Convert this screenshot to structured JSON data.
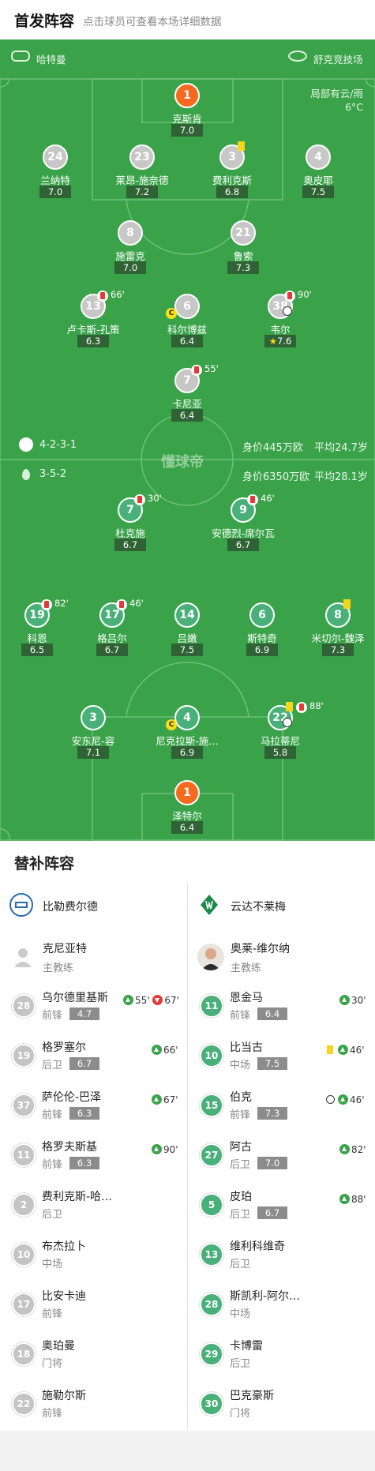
{
  "header": {
    "title": "首发阵容",
    "hint": "点击球员可查看本场详细数据"
  },
  "pitch": {
    "referee": "哈特曼",
    "stadium": "舒克竞技场",
    "weather": "局部有云/雨",
    "temperature": "6°C",
    "watermark": "懂球帝",
    "home_summary": {
      "formation": "4-2-3-1",
      "value": "身价445万欧",
      "age": "平均24.7岁"
    },
    "away_summary": {
      "formation": "3-5-2",
      "value": "身价6350万欧",
      "age": "平均28.1岁"
    }
  },
  "home_lineup": [
    {
      "num": "1",
      "name": "克斯肯",
      "rating": "7.0",
      "gk": true
    },
    {
      "num": "24",
      "name": "兰纳特",
      "rating": "7.0"
    },
    {
      "num": "23",
      "name": "莱昂-施奈德",
      "rating": "7.2"
    },
    {
      "num": "3",
      "name": "费利克斯",
      "rating": "6.8",
      "yellow": true
    },
    {
      "num": "4",
      "name": "奥皮耶",
      "rating": "7.5"
    },
    {
      "num": "8",
      "name": "施雷克",
      "rating": "7.0"
    },
    {
      "num": "21",
      "name": "鲁索",
      "rating": "7.3"
    },
    {
      "num": "13",
      "name": "卢卡斯-孔策",
      "rating": "6.3",
      "sub_time": "66'"
    },
    {
      "num": "6",
      "name": "科尔博兹",
      "rating": "6.4",
      "captain": true
    },
    {
      "num": "38",
      "name": "韦尔",
      "rating": "7.6",
      "sub_time": "90'",
      "goal": true,
      "star": true
    },
    {
      "num": "7",
      "name": "卡尼亚",
      "rating": "6.4",
      "sub_time": "55'"
    }
  ],
  "away_lineup": [
    {
      "num": "7",
      "name": "杜克施",
      "rating": "6.7",
      "sub_time": "30'"
    },
    {
      "num": "9",
      "name": "安德烈-席尔瓦",
      "rating": "6.7",
      "sub_time": "46'"
    },
    {
      "num": "19",
      "name": "科恩",
      "rating": "6.5",
      "sub_time": "82'"
    },
    {
      "num": "17",
      "name": "格吕尔",
      "rating": "6.7",
      "sub_time": "46'"
    },
    {
      "num": "14",
      "name": "吕嫩",
      "rating": "7.5"
    },
    {
      "num": "6",
      "name": "斯特奇",
      "rating": "6.9"
    },
    {
      "num": "8",
      "name": "米切尔-魏泽",
      "rating": "7.3",
      "yellow": true
    },
    {
      "num": "3",
      "name": "安东尼-容",
      "rating": "7.1"
    },
    {
      "num": "4",
      "name": "尼克拉斯-施…",
      "rating": "6.9",
      "captain": true
    },
    {
      "num": "22",
      "name": "马拉蒂尼",
      "rating": "5.8",
      "sub_time": "88'",
      "yellow": true,
      "goal": true
    },
    {
      "num": "1",
      "name": "泽特尔",
      "rating": "6.4",
      "gk": true
    }
  ],
  "subs": {
    "title": "替补阵容",
    "home": {
      "team": "比勒费尔德",
      "coach": {
        "name": "克尼亚特",
        "role": "主教练"
      },
      "players": [
        {
          "num": "28",
          "name": "乌尔德里基斯",
          "pos": "前锋",
          "rating": "4.7",
          "in": "55'",
          "out": "67'"
        },
        {
          "num": "19",
          "name": "格罗塞尔",
          "pos": "后卫",
          "rating": "6.7",
          "in": "66'"
        },
        {
          "num": "37",
          "name": "萨伦伦-巴泽",
          "pos": "前锋",
          "rating": "6.3",
          "in": "67'"
        },
        {
          "num": "11",
          "name": "格罗夫斯基",
          "pos": "前锋",
          "rating": "6.3",
          "in": "90'"
        },
        {
          "num": "2",
          "name": "费利克斯-哈…",
          "pos": "后卫"
        },
        {
          "num": "10",
          "name": "布杰拉卜",
          "pos": "中场"
        },
        {
          "num": "17",
          "name": "比安卡迪",
          "pos": "前锋"
        },
        {
          "num": "18",
          "name": "奥珀曼",
          "pos": "门将"
        },
        {
          "num": "22",
          "name": "施勒尔斯",
          "pos": "前锋"
        }
      ]
    },
    "away": {
      "team": "云达不莱梅",
      "coach": {
        "name": "奥莱-维尔纳",
        "role": "主教练"
      },
      "players": [
        {
          "num": "11",
          "name": "恩金马",
          "pos": "前锋",
          "rating": "6.4",
          "in": "30'"
        },
        {
          "num": "10",
          "name": "比当古",
          "pos": "中场",
          "rating": "7.5",
          "in": "46'",
          "yellow": true
        },
        {
          "num": "15",
          "name": "伯克",
          "pos": "前锋",
          "rating": "7.3",
          "in": "46'",
          "goal": true
        },
        {
          "num": "27",
          "name": "阿古",
          "pos": "后卫",
          "rating": "7.0",
          "in": "82'"
        },
        {
          "num": "5",
          "name": "皮珀",
          "pos": "后卫",
          "rating": "6.7",
          "in": "88'"
        },
        {
          "num": "13",
          "name": "维利科维奇",
          "pos": "后卫"
        },
        {
          "num": "28",
          "name": "斯凯利-阿尔…",
          "pos": "中场"
        },
        {
          "num": "29",
          "name": "卡博雷",
          "pos": "后卫"
        },
        {
          "num": "30",
          "name": "巴克豪斯",
          "pos": "门将"
        }
      ]
    }
  }
}
